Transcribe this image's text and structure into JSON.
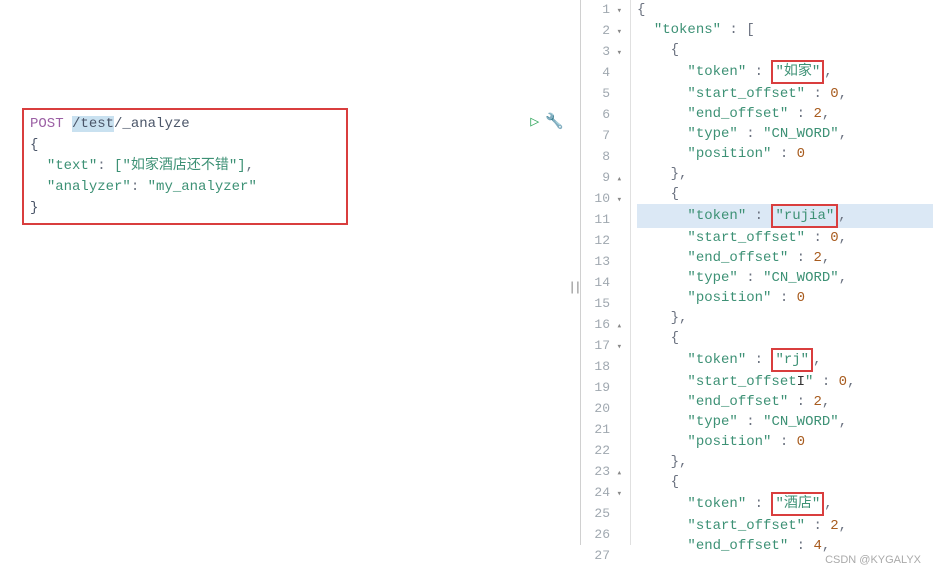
{
  "request": {
    "method": "POST",
    "url_prefix": " ",
    "url_selected": "/test",
    "url_suffix": "/_analyze",
    "body_open": "{",
    "text_key": "\"text\"",
    "text_value": "[\"如家酒店还不错\"]",
    "analyzer_key": "\"analyzer\"",
    "analyzer_value": "\"my_analyzer\"",
    "body_close": "}"
  },
  "icons": {
    "play": "▷",
    "wrench": "🔧",
    "divider": "||"
  },
  "response": {
    "lines": [
      {
        "num": "1",
        "fold": "▾",
        "indent": "",
        "content": [
          {
            "t": "punct",
            "v": "{"
          }
        ]
      },
      {
        "num": "2",
        "fold": "▾",
        "indent": "  ",
        "content": [
          {
            "t": "rkey",
            "v": "\"tokens\""
          },
          {
            "t": "punct",
            "v": " : ["
          }
        ]
      },
      {
        "num": "3",
        "fold": "▾",
        "indent": "    ",
        "content": [
          {
            "t": "punct",
            "v": "{"
          }
        ]
      },
      {
        "num": "4",
        "fold": "",
        "indent": "      ",
        "content": [
          {
            "t": "rkey",
            "v": "\"token\""
          },
          {
            "t": "punct",
            "v": " : "
          },
          {
            "t": "boxed",
            "v": "\"如家\""
          },
          {
            "t": "punct",
            "v": ","
          }
        ]
      },
      {
        "num": "5",
        "fold": "",
        "indent": "      ",
        "content": [
          {
            "t": "rkey",
            "v": "\"start_offset\""
          },
          {
            "t": "punct",
            "v": " : "
          },
          {
            "t": "rval-num",
            "v": "0"
          },
          {
            "t": "punct",
            "v": ","
          }
        ]
      },
      {
        "num": "6",
        "fold": "",
        "indent": "      ",
        "content": [
          {
            "t": "rkey",
            "v": "\"end_offset\""
          },
          {
            "t": "punct",
            "v": " : "
          },
          {
            "t": "rval-num",
            "v": "2"
          },
          {
            "t": "punct",
            "v": ","
          }
        ]
      },
      {
        "num": "7",
        "fold": "",
        "indent": "      ",
        "content": [
          {
            "t": "rkey",
            "v": "\"type\""
          },
          {
            "t": "punct",
            "v": " : "
          },
          {
            "t": "rval-str",
            "v": "\"CN_WORD\""
          },
          {
            "t": "punct",
            "v": ","
          }
        ]
      },
      {
        "num": "8",
        "fold": "",
        "indent": "      ",
        "content": [
          {
            "t": "rkey",
            "v": "\"position\""
          },
          {
            "t": "punct",
            "v": " : "
          },
          {
            "t": "rval-num",
            "v": "0"
          }
        ]
      },
      {
        "num": "9",
        "fold": "▴",
        "indent": "    ",
        "content": [
          {
            "t": "punct",
            "v": "},"
          }
        ]
      },
      {
        "num": "10",
        "fold": "▾",
        "indent": "    ",
        "content": [
          {
            "t": "punct",
            "v": "{"
          }
        ]
      },
      {
        "num": "11",
        "fold": "",
        "indent": "      ",
        "hl": true,
        "content": [
          {
            "t": "rkey",
            "v": "\"token\""
          },
          {
            "t": "punct",
            "v": " : "
          },
          {
            "t": "boxed",
            "v": "\"rujia\""
          },
          {
            "t": "punct",
            "v": ","
          }
        ]
      },
      {
        "num": "12",
        "fold": "",
        "indent": "      ",
        "content": [
          {
            "t": "rkey",
            "v": "\"start_offset\""
          },
          {
            "t": "punct",
            "v": " : "
          },
          {
            "t": "rval-num",
            "v": "0"
          },
          {
            "t": "punct",
            "v": ","
          }
        ]
      },
      {
        "num": "13",
        "fold": "",
        "indent": "      ",
        "content": [
          {
            "t": "rkey",
            "v": "\"end_offset\""
          },
          {
            "t": "punct",
            "v": " : "
          },
          {
            "t": "rval-num",
            "v": "2"
          },
          {
            "t": "punct",
            "v": ","
          }
        ]
      },
      {
        "num": "14",
        "fold": "",
        "indent": "      ",
        "content": [
          {
            "t": "rkey",
            "v": "\"type\""
          },
          {
            "t": "punct",
            "v": " : "
          },
          {
            "t": "rval-str",
            "v": "\"CN_WORD\""
          },
          {
            "t": "punct",
            "v": ","
          }
        ]
      },
      {
        "num": "15",
        "fold": "",
        "indent": "      ",
        "content": [
          {
            "t": "rkey",
            "v": "\"position\""
          },
          {
            "t": "punct",
            "v": " : "
          },
          {
            "t": "rval-num",
            "v": "0"
          }
        ]
      },
      {
        "num": "16",
        "fold": "▴",
        "indent": "    ",
        "content": [
          {
            "t": "punct",
            "v": "},"
          }
        ]
      },
      {
        "num": "17",
        "fold": "▾",
        "indent": "    ",
        "content": [
          {
            "t": "punct",
            "v": "{"
          }
        ]
      },
      {
        "num": "18",
        "fold": "",
        "indent": "      ",
        "content": [
          {
            "t": "rkey",
            "v": "\"token\""
          },
          {
            "t": "punct",
            "v": " : "
          },
          {
            "t": "boxed",
            "v": "\"rj\""
          },
          {
            "t": "punct",
            "v": ","
          }
        ]
      },
      {
        "num": "19",
        "fold": "",
        "indent": "      ",
        "content": [
          {
            "t": "rkey",
            "v": "\"start_offset"
          },
          {
            "t": "cursor",
            "v": "I"
          },
          {
            "t": "rkey",
            "v": "\""
          },
          {
            "t": "punct",
            "v": " : "
          },
          {
            "t": "rval-num",
            "v": "0"
          },
          {
            "t": "punct",
            "v": ","
          }
        ]
      },
      {
        "num": "20",
        "fold": "",
        "indent": "      ",
        "content": [
          {
            "t": "rkey",
            "v": "\"end_offset\""
          },
          {
            "t": "punct",
            "v": " : "
          },
          {
            "t": "rval-num",
            "v": "2"
          },
          {
            "t": "punct",
            "v": ","
          }
        ]
      },
      {
        "num": "21",
        "fold": "",
        "indent": "      ",
        "content": [
          {
            "t": "rkey",
            "v": "\"type\""
          },
          {
            "t": "punct",
            "v": " : "
          },
          {
            "t": "rval-str",
            "v": "\"CN_WORD\""
          },
          {
            "t": "punct",
            "v": ","
          }
        ]
      },
      {
        "num": "22",
        "fold": "",
        "indent": "      ",
        "content": [
          {
            "t": "rkey",
            "v": "\"position\""
          },
          {
            "t": "punct",
            "v": " : "
          },
          {
            "t": "rval-num",
            "v": "0"
          }
        ]
      },
      {
        "num": "23",
        "fold": "▴",
        "indent": "    ",
        "content": [
          {
            "t": "punct",
            "v": "},"
          }
        ]
      },
      {
        "num": "24",
        "fold": "▾",
        "indent": "    ",
        "content": [
          {
            "t": "punct",
            "v": "{"
          }
        ]
      },
      {
        "num": "25",
        "fold": "",
        "indent": "      ",
        "content": [
          {
            "t": "rkey",
            "v": "\"token\""
          },
          {
            "t": "punct",
            "v": " : "
          },
          {
            "t": "boxed",
            "v": "\"酒店\""
          },
          {
            "t": "punct",
            "v": ","
          }
        ]
      },
      {
        "num": "26",
        "fold": "",
        "indent": "      ",
        "content": [
          {
            "t": "rkey",
            "v": "\"start_offset\""
          },
          {
            "t": "punct",
            "v": " : "
          },
          {
            "t": "rval-num",
            "v": "2"
          },
          {
            "t": "punct",
            "v": ","
          }
        ]
      },
      {
        "num": "27",
        "fold": "",
        "indent": "      ",
        "content": [
          {
            "t": "rkey",
            "v": "\"end_offset\""
          },
          {
            "t": "punct",
            "v": " : "
          },
          {
            "t": "rval-num",
            "v": "4"
          },
          {
            "t": "punct",
            "v": ","
          }
        ]
      }
    ]
  },
  "watermark": "CSDN @KYGALYX"
}
